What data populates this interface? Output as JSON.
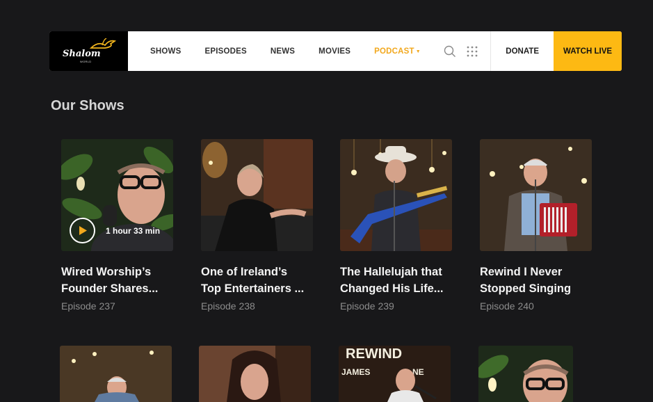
{
  "header": {
    "logo_text": "Shalom",
    "logo_sub": "WORLD",
    "nav": [
      {
        "label": "SHOWS"
      },
      {
        "label": "EPISODES"
      },
      {
        "label": "NEWS"
      },
      {
        "label": "MOVIES"
      },
      {
        "label": "PODCAST",
        "active": true
      }
    ],
    "search_icon": "search-icon",
    "apps_icon": "apps-grid-icon",
    "donate_label": "DONATE",
    "watch_live_label": "WATCH LIVE",
    "accent_color": "#fdb913"
  },
  "section": {
    "title": "Our Shows"
  },
  "shows": [
    {
      "title_line1": "Wired Worship’s",
      "title_line2": "Founder Shares...",
      "episode": "Episode 237",
      "duration": "1 hour 33 min"
    },
    {
      "title_line1": "One of Ireland’s",
      "title_line2": "Top Entertainers ...",
      "episode": "Episode 238"
    },
    {
      "title_line1": "The Hallelujah that",
      "title_line2": "Changed His Life...",
      "episode": "Episode 239"
    },
    {
      "title_line1": "Rewind I Never",
      "title_line2": "Stopped Singing",
      "episode": "Episode 240"
    }
  ],
  "row2_banner": {
    "line1": "REWIND",
    "line2": "JAMES",
    "line3": "NE"
  }
}
